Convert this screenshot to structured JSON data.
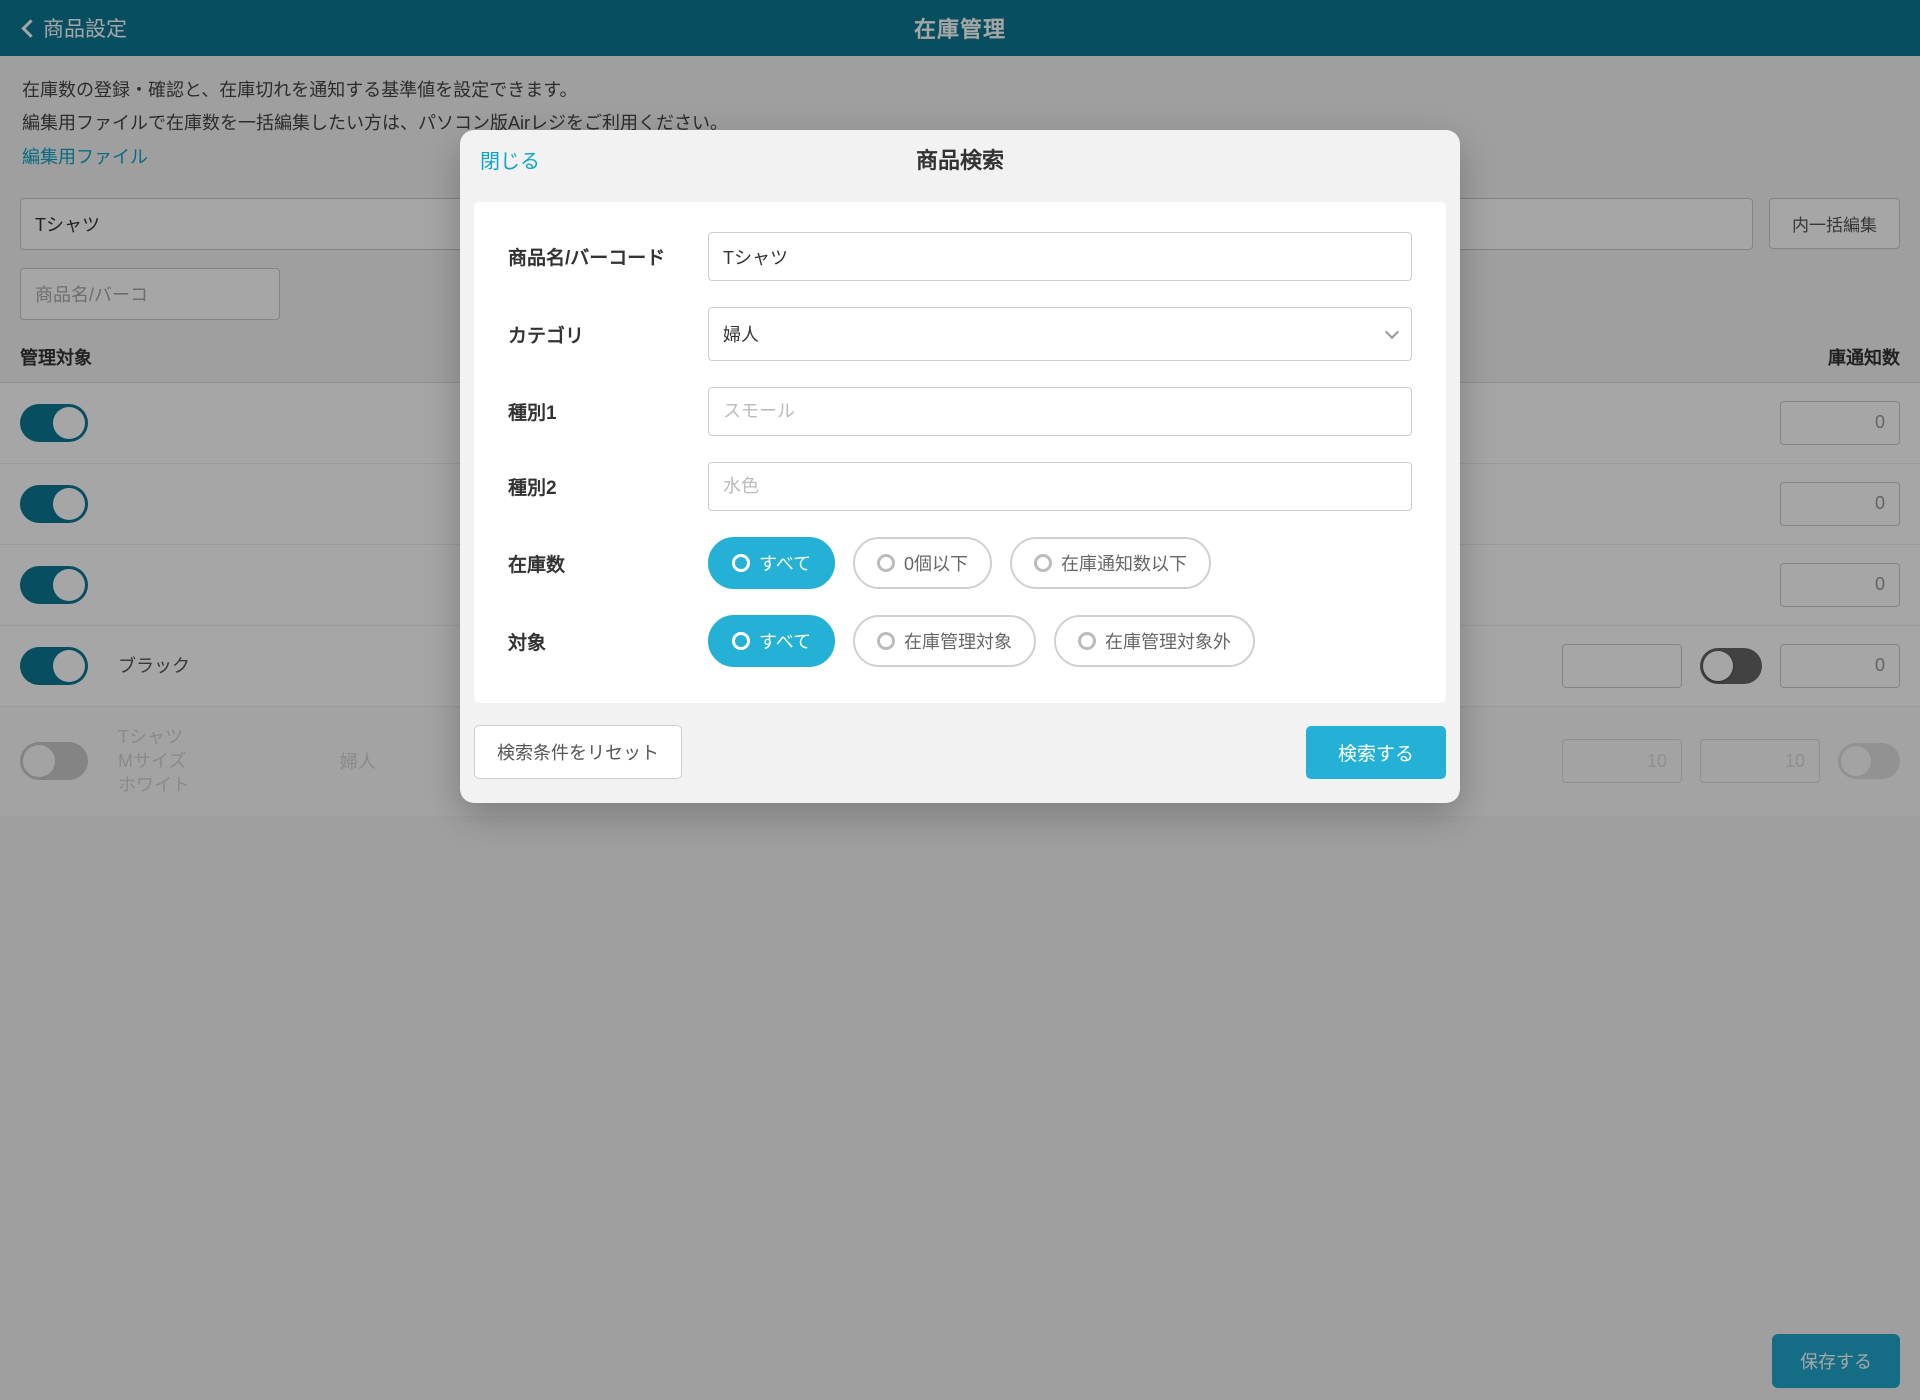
{
  "topbar": {
    "back_label": "商品設定",
    "title": "在庫管理"
  },
  "desc": {
    "line1": "在庫数の登録・確認と、在庫切れを通知する基準値を設定できます。",
    "line2": "編集用ファイルで在庫数を一括編集したい方は、パソコン版Airレジをご利用ください。",
    "link_text": "編集用ファイル"
  },
  "bg_toolbar": {
    "search_value": "Tシャツ",
    "bulk_edit": "内一括編集",
    "search_placeholder": "商品名/バーコ"
  },
  "table": {
    "head_mgmt": "管理対象",
    "head_notify": "庫通知数"
  },
  "rows": [
    {
      "line1": "",
      "line2": "ブラック",
      "val1": "",
      "val2": "0"
    },
    {
      "line1": "Tシャツ",
      "line2": "Mサイズ",
      "line3": "ホワイト",
      "val1": "10",
      "val2": "10"
    }
  ],
  "save": {
    "label": "保存する"
  },
  "modal": {
    "close": "閉じる",
    "title": "商品検索",
    "fld_name": "商品名/バーコード",
    "fld_name_value": "Tシャツ",
    "fld_category": "カテゴリ",
    "fld_category_value": "婦人",
    "fld_type1": "種別1",
    "fld_type1_ph": "スモール",
    "fld_type2": "種別2",
    "fld_type2_ph": "水色",
    "fld_stock": "在庫数",
    "stock_opts": [
      "すべて",
      "0個以下",
      "在庫通知数以下"
    ],
    "fld_target": "対象",
    "target_opts": [
      "すべて",
      "在庫管理対象",
      "在庫管理対象外"
    ],
    "reset": "検索条件をリセット",
    "search": "検索する"
  }
}
